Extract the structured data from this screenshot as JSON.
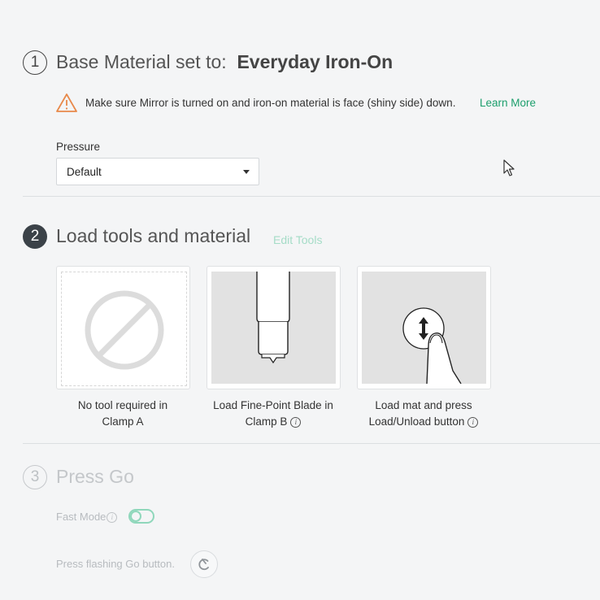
{
  "section1": {
    "step_number": "1",
    "title_prefix": "Base Material set to:",
    "material": "Everyday Iron-On",
    "warning_text": "Make sure Mirror is turned on and iron-on material is face (shiny side) down.",
    "learn_more": "Learn More",
    "pressure_label": "Pressure",
    "pressure_value": "Default"
  },
  "section2": {
    "step_number": "2",
    "title": "Load tools and material",
    "edit_tools": "Edit Tools",
    "cards": [
      {
        "caption_line1": "No tool required in",
        "caption_line2": "Clamp A",
        "icon": "no-tool-icon"
      },
      {
        "caption_line1": "Load Fine-Point Blade in",
        "caption_line2": "Clamp B",
        "icon": "fine-point-blade-icon",
        "info": "i"
      },
      {
        "caption_line1": "Load mat and press",
        "caption_line2": "Load/Unload button",
        "icon": "load-unload-press-icon",
        "info": "i"
      }
    ]
  },
  "section3": {
    "step_number": "3",
    "title": "Press Go",
    "fast_mode_label": "Fast Mode",
    "fast_mode_info": "i",
    "go_instruction": "Press flashing Go button."
  },
  "colors": {
    "accent": "#1b9e6c",
    "accent_light": "#8fd7bb",
    "warning": "#e8894a",
    "step_filled": "#3b4248",
    "background": "#f4f5f6"
  }
}
